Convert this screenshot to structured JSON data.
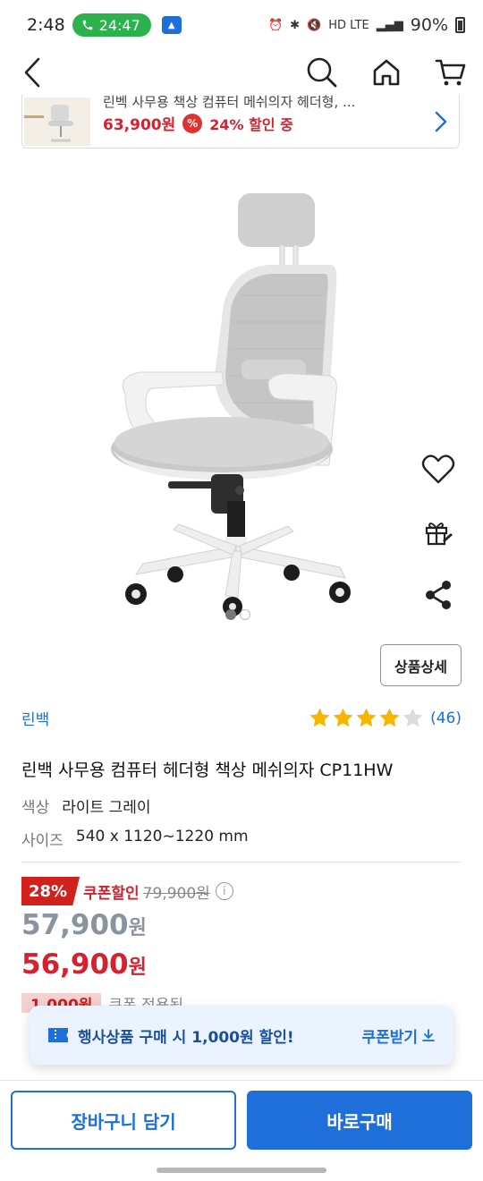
{
  "status_bar": {
    "time": "2:48",
    "call_duration": "24:47",
    "network_labels": "HD LTE",
    "battery": "90%"
  },
  "related_product": {
    "title": "린벡 사무용 책상 컴퓨터 메쉬의자 헤더형, ...",
    "price": "63,900원",
    "discount_text": "24% 할인 중"
  },
  "product": {
    "detail_button_label": "상품상세",
    "brand": "린백",
    "rating_stars": 4,
    "review_count": "(46)",
    "title": "린백 사무용 컴퓨터 헤더형 책상 메쉬의자 CP11HW",
    "options": [
      {
        "label": "색상",
        "value": "라이트 그레이"
      },
      {
        "label": "사이즈",
        "value": "540 x 1120~1220 mm"
      }
    ]
  },
  "pricing": {
    "discount_percent": "28%",
    "coupon_label": "쿠폰할인",
    "original_price": "79,900원",
    "sale_price_number": "57,900",
    "final_price_number": "56,900",
    "currency": "원",
    "partial_chip": "1,000원",
    "partial_text": "쿠폰 적용됨"
  },
  "toast": {
    "message": "행사상품 구매 시 1,000원 할인!",
    "action": "쿠폰받기"
  },
  "bottom_bar": {
    "cart_label": "장바구니 담기",
    "buy_label": "바로구매"
  },
  "colors": {
    "accent_blue": "#1e6fd9",
    "price_red": "#d5222e",
    "star_yellow": "#f6b500"
  },
  "icons": [
    "back-icon",
    "search-icon",
    "home-icon",
    "cart-icon",
    "heart-icon",
    "gift-icon",
    "share-icon",
    "info-icon",
    "chevron-right-icon",
    "coupon-icon",
    "download-icon"
  ]
}
